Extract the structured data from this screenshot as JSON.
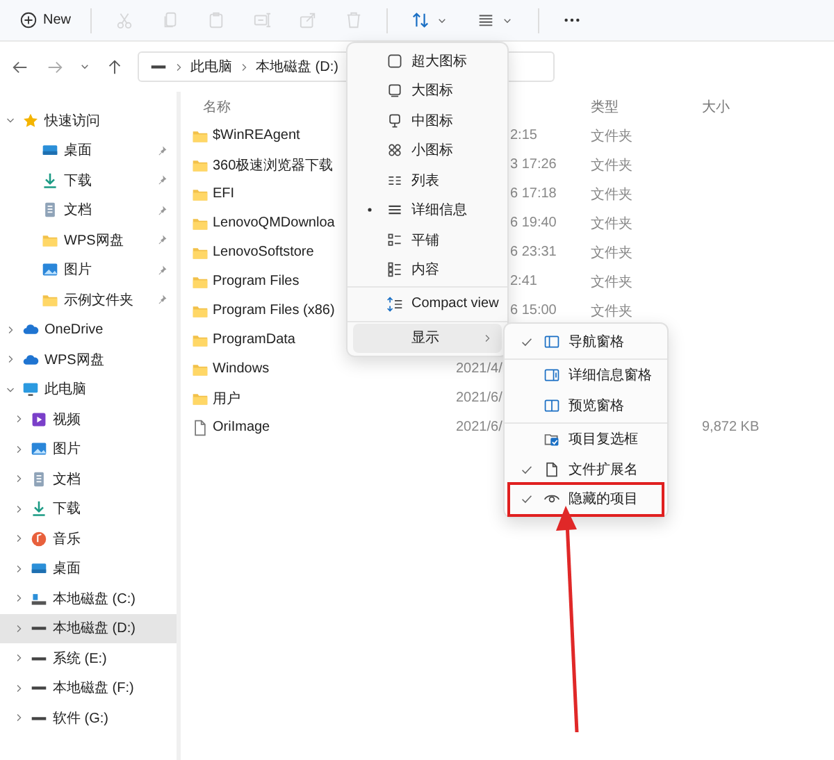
{
  "toolbar": {
    "new_button": {
      "label": "New"
    },
    "tools": [
      {
        "kind": "cut",
        "disabled": true
      },
      {
        "kind": "copy",
        "disabled": true
      },
      {
        "kind": "paste",
        "disabled": true
      },
      {
        "kind": "rename",
        "disabled": true
      },
      {
        "kind": "share",
        "disabled": true
      },
      {
        "kind": "delete",
        "disabled": true
      },
      {
        "kind": "sort",
        "disabled": false
      },
      {
        "kind": "view",
        "disabled": false
      },
      {
        "kind": "more",
        "disabled": false
      }
    ]
  },
  "address_bar": {
    "breadcrumbs": [
      "此电脑",
      "本地磁盘 (D:)"
    ]
  },
  "sidebar": {
    "items": [
      {
        "label": "快速访问",
        "kind": "star",
        "expanded": true,
        "selected": false,
        "children": [
          {
            "label": "桌面",
            "kind": "desktop",
            "pinned": true,
            "selected": false
          },
          {
            "label": "下载",
            "kind": "download",
            "pinned": true,
            "selected": false
          },
          {
            "label": "文档",
            "kind": "document",
            "pinned": true,
            "selected": false
          },
          {
            "label": "WPS网盘",
            "kind": "folder",
            "pinned": true,
            "selected": false
          },
          {
            "label": "图片",
            "kind": "picture",
            "pinned": true,
            "selected": false
          },
          {
            "label": "示例文件夹",
            "kind": "folder",
            "pinned": true,
            "selected": false
          }
        ]
      },
      {
        "label": "OneDrive",
        "kind": "cloud",
        "expanded": false,
        "selected": false
      },
      {
        "label": "WPS网盘",
        "kind": "cloud",
        "expanded": false,
        "selected": false
      },
      {
        "label": "此电脑",
        "kind": "computer",
        "expanded": true,
        "selected": false,
        "children": [
          {
            "label": "视频",
            "kind": "video",
            "expanded": false,
            "selected": false
          },
          {
            "label": "图片",
            "kind": "picture",
            "expanded": false,
            "selected": false
          },
          {
            "label": "文档",
            "kind": "document",
            "expanded": false,
            "selected": false
          },
          {
            "label": "下载",
            "kind": "download",
            "expanded": false,
            "selected": false
          },
          {
            "label": "音乐",
            "kind": "music",
            "expanded": false,
            "selected": false
          },
          {
            "label": "桌面",
            "kind": "desktop",
            "expanded": false,
            "selected": false
          },
          {
            "label": "本地磁盘 (C:)",
            "kind": "system-drive",
            "expanded": false,
            "selected": false
          },
          {
            "label": "本地磁盘 (D:)",
            "kind": "drive",
            "expanded": false,
            "selected": true
          },
          {
            "label": "系统 (E:)",
            "kind": "drive",
            "expanded": false,
            "selected": false
          },
          {
            "label": "本地磁盘 (F:)",
            "kind": "drive",
            "expanded": false,
            "selected": false
          },
          {
            "label": "软件 (G:)",
            "kind": "drive",
            "expanded": false,
            "selected": false
          }
        ]
      }
    ]
  },
  "file_list": {
    "columns": [
      "名称",
      "类型",
      "大小"
    ],
    "rows": [
      {
        "name": "$WinREAgent",
        "kind": "folder",
        "date": "2:15",
        "type": "文件夹"
      },
      {
        "name": "360极速浏览器下载",
        "kind": "folder",
        "date": "3 17:26",
        "type": "文件夹"
      },
      {
        "name": "EFI",
        "kind": "folder",
        "date": "6 17:18",
        "type": "文件夹"
      },
      {
        "name": "LenovoQMDownloa",
        "kind": "folder",
        "date": "6 19:40",
        "type": "文件夹"
      },
      {
        "name": "LenovoSoftstore",
        "kind": "folder",
        "date": "6 23:31",
        "type": "文件夹"
      },
      {
        "name": "Program Files",
        "kind": "folder",
        "date": "2:41",
        "type": "文件夹"
      },
      {
        "name": "Program Files (x86)",
        "kind": "folder",
        "date": "6 15:00",
        "type": "文件夹"
      },
      {
        "name": "ProgramData",
        "kind": "folder"
      },
      {
        "name": "Windows",
        "kind": "folder",
        "date": "2021/4/"
      },
      {
        "name": "用户",
        "kind": "folder",
        "date": "2021/6/"
      },
      {
        "name": "OriImage",
        "kind": "file",
        "date": "2021/6/",
        "size": "9,872 KB"
      }
    ]
  },
  "view_menu": {
    "layouts": [
      {
        "label": "超大图标",
        "kind": "extra-large",
        "selected": false
      },
      {
        "label": "大图标",
        "kind": "large",
        "selected": false
      },
      {
        "label": "中图标",
        "kind": "medium",
        "selected": false
      },
      {
        "label": "小图标",
        "kind": "small",
        "selected": false
      },
      {
        "label": "列表",
        "kind": "list",
        "selected": false
      },
      {
        "label": "详细信息",
        "kind": "details",
        "selected": true
      },
      {
        "label": "平铺",
        "kind": "tiles",
        "selected": false
      },
      {
        "label": "内容",
        "kind": "content",
        "selected": false
      }
    ],
    "compact": {
      "label": "Compact view"
    },
    "show": {
      "label": "显示",
      "highlighted": true
    }
  },
  "show_menu": {
    "groups": [
      [
        {
          "label": "导航窗格",
          "kind": "nav-pane",
          "checked": true,
          "annotated": false
        }
      ],
      [
        {
          "label": "详细信息窗格",
          "kind": "details-pane",
          "checked": false,
          "annotated": false
        },
        {
          "label": "预览窗格",
          "kind": "preview-pane",
          "checked": false,
          "annotated": false
        }
      ],
      [
        {
          "label": "项目复选框",
          "kind": "checkboxes",
          "checked": false,
          "annotated": false
        },
        {
          "label": "文件扩展名",
          "kind": "extensions",
          "checked": true,
          "annotated": false
        },
        {
          "label": "隐藏的项目",
          "kind": "eye",
          "checked": true,
          "annotated": true
        }
      ]
    ]
  }
}
